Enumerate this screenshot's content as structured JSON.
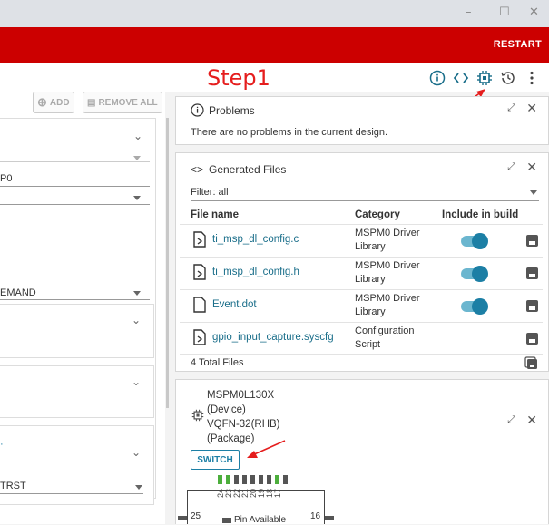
{
  "window": {
    "minimize": "–",
    "maximize": "☐",
    "close": "✕"
  },
  "header": {
    "restart": "RESTART",
    "step_label": "Step1"
  },
  "toolbar": {
    "icons": [
      "info-icon",
      "code-icon",
      "chip-icon",
      "history-icon",
      "more-icon"
    ]
  },
  "left": {
    "add_label": "ADD",
    "remove_all_label": "REMOVE ALL",
    "fields": {
      "field1": "P0",
      "field2": "EMAND",
      "field3": "TRST"
    }
  },
  "problems": {
    "title": "Problems",
    "message": "There are no problems in the current design."
  },
  "generated": {
    "title": "Generated Files",
    "filter_label": "Filter: all",
    "headers": {
      "name": "File name",
      "category": "Category",
      "include": "Include in build"
    },
    "files": [
      {
        "name": "ti_msp_dl_config.c",
        "cat1": "MSPM0 Driver",
        "cat2": "Library"
      },
      {
        "name": "ti_msp_dl_config.h",
        "cat1": "MSPM0 Driver",
        "cat2": "Library"
      },
      {
        "name": "Event.dot",
        "cat1": "MSPM0 Driver",
        "cat2": "Library"
      },
      {
        "name": "gpio_input_capture.syscfg",
        "cat1": "Configuration",
        "cat2": "Script"
      }
    ],
    "total": "4 Total Files"
  },
  "device": {
    "name": "MSPM0L130X",
    "type": "(Device)",
    "package": "VQFN-32(RHB)",
    "package_label": "(Package)",
    "switch_label": "SWITCH",
    "pins_top": [
      "24",
      "23",
      "22",
      "21",
      "20",
      "19",
      "18",
      "17"
    ],
    "pin_left": "25",
    "pin_right": "16",
    "pin_legend": "Pin Available"
  },
  "colors": {
    "brand": "#cc0000",
    "accent": "#1c7fa5",
    "annotation": "#e51d1d"
  }
}
